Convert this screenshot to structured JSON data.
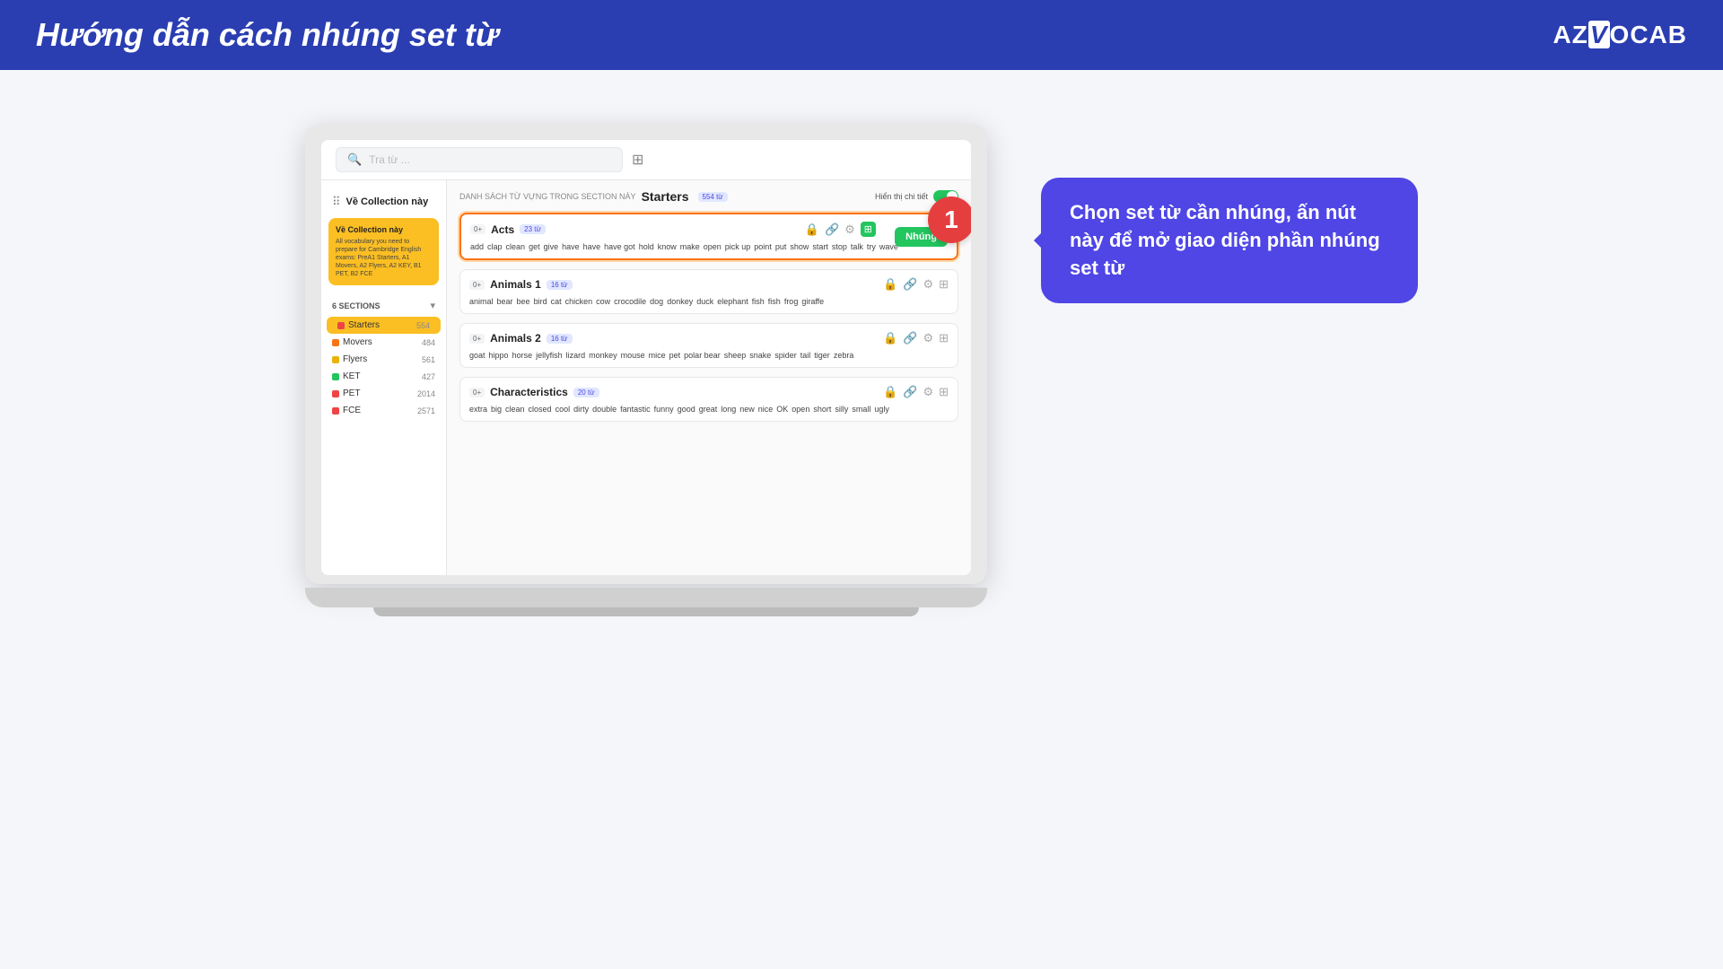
{
  "header": {
    "title": "Hướng dẫn cách nhúng set từ",
    "logo": "AZVOCAB"
  },
  "app": {
    "search_placeholder": "Tra từ ...",
    "collection_title": "Về Collection này",
    "collection_desc": "All vocabulary you need to prepare for Cambridge English exams: PreA1 Starters, A1 Movers, A2 Flyers, A2 KEY, B1 PET, B2 FCE",
    "sections_label": "6 SECTIONS",
    "section_header_prefix": "DANH SÁCH TỪ VỰNG TRONG SECTION NÀY",
    "section_name": "Starters",
    "section_badge": "554 từ",
    "toggle_label": "Hiển thị chi tiết",
    "sections": [
      {
        "name": "Starters",
        "count": "554",
        "color": "#ef4444",
        "active": true
      },
      {
        "name": "Movers",
        "count": "484",
        "color": "#f97316",
        "active": false
      },
      {
        "name": "Flyers",
        "count": "561",
        "color": "#eab308",
        "active": false
      },
      {
        "name": "KET",
        "count": "427",
        "color": "#22c55e",
        "active": false
      },
      {
        "name": "PET",
        "count": "2014",
        "color": "#ef4444",
        "active": false
      },
      {
        "name": "FCE",
        "count": "2571",
        "color": "#ef4444",
        "active": false
      }
    ],
    "word_sets": [
      {
        "id": "acts",
        "title": "Acts",
        "word_count": "23 từ",
        "level": "0+",
        "highlighted": true,
        "words": [
          "add",
          "clap",
          "clean",
          "get",
          "give",
          "have",
          "have",
          "have got",
          "hold",
          "know",
          "make",
          "open",
          "pick up",
          "point",
          "put",
          "show",
          "start",
          "stop",
          "talk",
          "try",
          "wave"
        ],
        "nhung_btn": "Nhúng"
      },
      {
        "id": "animals1",
        "title": "Animals 1",
        "word_count": "16 từ",
        "level": "0+",
        "highlighted": false,
        "words": [
          "animal",
          "bear",
          "bee",
          "bird",
          "cat",
          "chicken",
          "cow",
          "crocodile",
          "dog",
          "donkey",
          "duck",
          "elephant",
          "fish",
          "fish",
          "frog",
          "giraffe"
        ],
        "nhung_btn": null
      },
      {
        "id": "animals2",
        "title": "Animals 2",
        "word_count": "16 từ",
        "level": "0+",
        "highlighted": false,
        "words": [
          "goat",
          "hippo",
          "horse",
          "jellyfish",
          "lizard",
          "monkey",
          "mouse",
          "mice",
          "pet",
          "polar bear",
          "sheep",
          "snake",
          "spider",
          "tail",
          "tiger",
          "zebra"
        ],
        "nhung_btn": null
      },
      {
        "id": "characteristics",
        "title": "Characteristics",
        "word_count": "20 từ",
        "level": "0+",
        "highlighted": false,
        "words": [
          "extra",
          "big",
          "clean",
          "closed",
          "cool",
          "dirty",
          "double",
          "fantastic",
          "funny",
          "good",
          "great",
          "long",
          "new",
          "nice",
          "OK",
          "open",
          "short",
          "silly",
          "small",
          "ugly"
        ],
        "nhung_btn": null
      }
    ]
  },
  "tooltip": {
    "text": "Chọn set từ cần nhúng, ấn nút này để mở giao diện phần nhúng set từ"
  },
  "number_badge": "1"
}
